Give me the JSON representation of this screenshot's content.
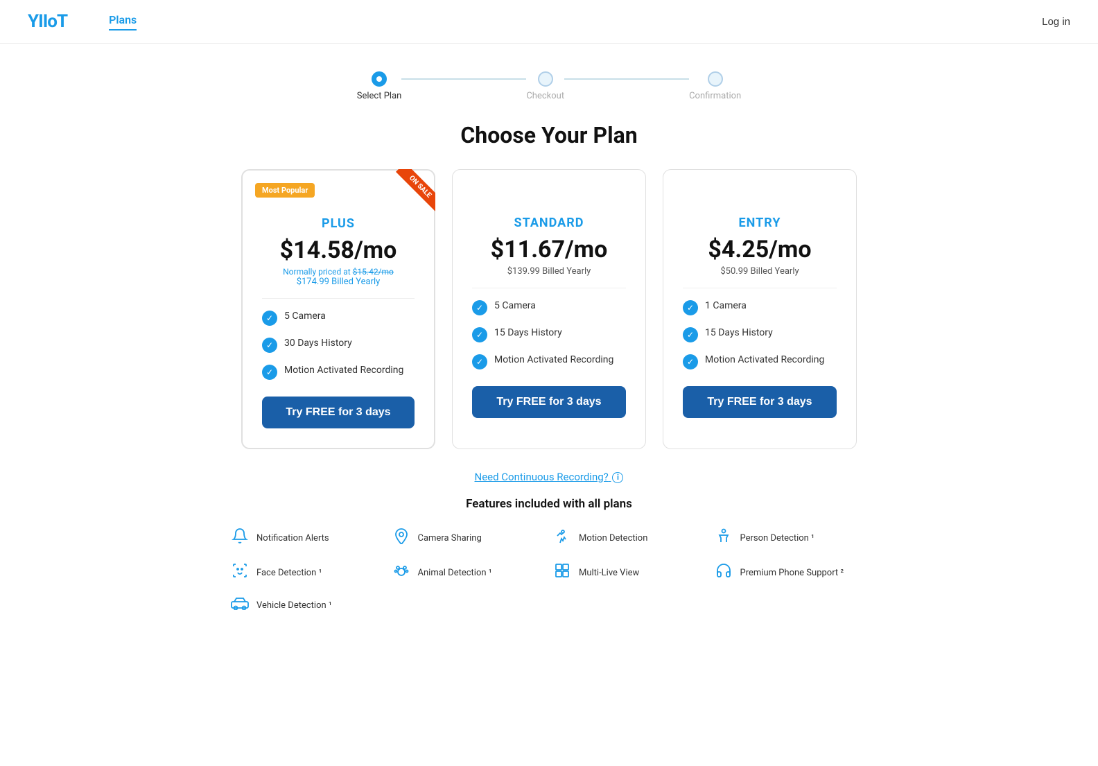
{
  "header": {
    "logo": "YIIoT",
    "nav_plans": "Plans",
    "login": "Log in"
  },
  "progress": {
    "steps": [
      {
        "id": "select-plan",
        "label": "Select Plan",
        "state": "active"
      },
      {
        "id": "checkout",
        "label": "Checkout",
        "state": "inactive"
      },
      {
        "id": "confirmation",
        "label": "Confirmation",
        "state": "inactive"
      }
    ]
  },
  "page_title": "Choose Your Plan",
  "plans": [
    {
      "id": "plus",
      "name": "PLUS",
      "badge": "Most Popular",
      "on_sale": true,
      "price": "$14.58/mo",
      "normally_label": "Normally priced at ",
      "normally_price": "$15.42/mo",
      "billed": "$174.99 Billed Yearly",
      "billed_type": "sale",
      "features": [
        "5 Camera",
        "30 Days History",
        "Motion Activated Recording"
      ],
      "cta": "Try FREE for 3 days"
    },
    {
      "id": "standard",
      "name": "STANDARD",
      "badge": null,
      "on_sale": false,
      "price": "$11.67/mo",
      "normally_label": null,
      "normally_price": null,
      "billed": "$139.99 Billed Yearly",
      "billed_type": "plain",
      "features": [
        "5 Camera",
        "15 Days History",
        "Motion Activated Recording"
      ],
      "cta": "Try FREE for 3 days"
    },
    {
      "id": "entry",
      "name": "ENTRY",
      "badge": null,
      "on_sale": false,
      "price": "$4.25/mo",
      "normally_label": null,
      "normally_price": null,
      "billed": "$50.99 Billed Yearly",
      "billed_type": "plain",
      "features": [
        "1 Camera",
        "15 Days History",
        "Motion Activated Recording"
      ],
      "cta": "Try FREE for 3 days"
    }
  ],
  "continuous_recording": {
    "text": "Need Continuous Recording?",
    "info": "i"
  },
  "features_section": {
    "title": "Features included with all plans",
    "items": [
      {
        "icon": "🔔",
        "label": "Notification Alerts"
      },
      {
        "icon": "📍",
        "label": "Camera Sharing"
      },
      {
        "icon": "🏃",
        "label": "Motion Detection"
      },
      {
        "icon": "🚶",
        "label": "Person Detection ¹"
      },
      {
        "icon": "😊",
        "label": "Face Detection ¹"
      },
      {
        "icon": "🐾",
        "label": "Animal Detection ¹"
      },
      {
        "icon": "⊞",
        "label": "Multi-Live View"
      },
      {
        "icon": "🎧",
        "label": "Premium Phone Support ²"
      },
      {
        "icon": "🚗",
        "label": "Vehicle Detection ¹"
      }
    ]
  }
}
